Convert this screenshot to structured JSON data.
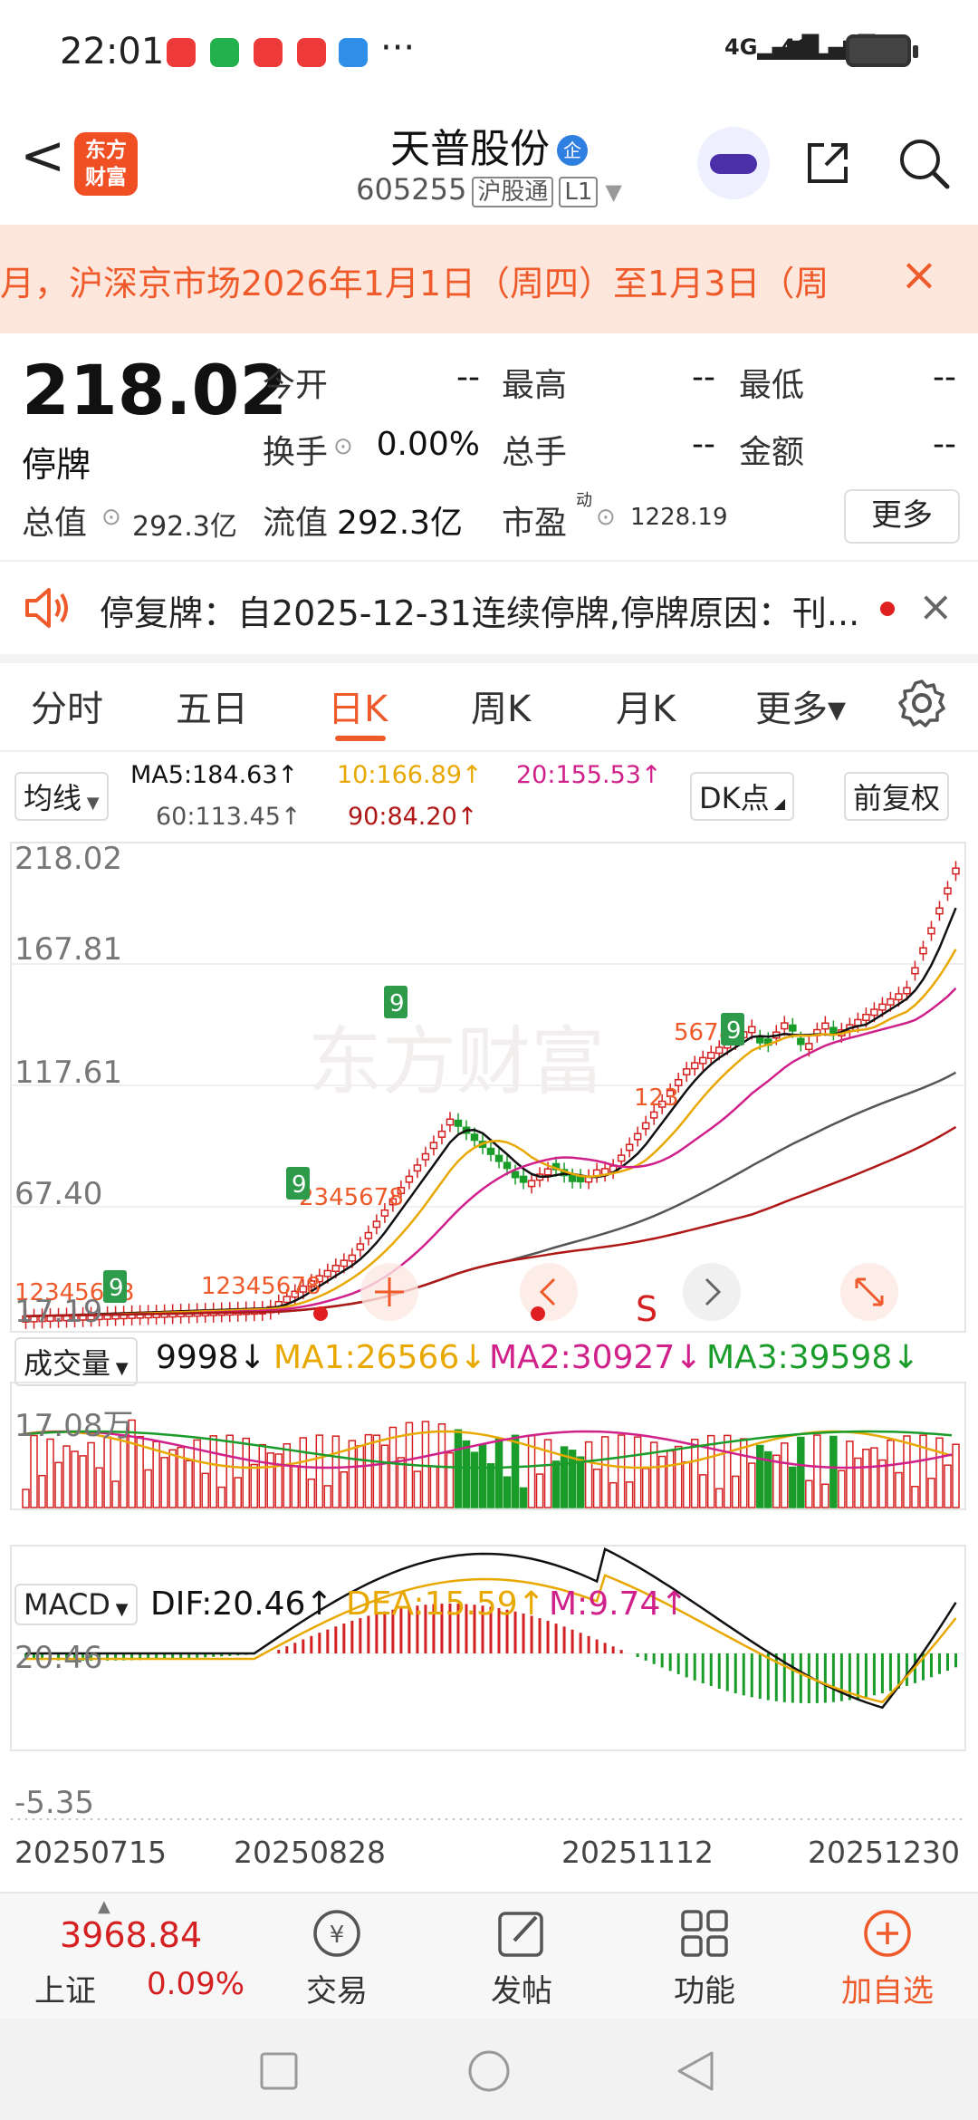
{
  "status_bar": {
    "time": "22:01",
    "dots": "···",
    "net1": "4G",
    "net2": "4G"
  },
  "header": {
    "back": "<",
    "logo_line1": "东方",
    "logo_line2": "财富",
    "stock_name": "天普股份",
    "badge": "企",
    "code": "605255",
    "tag1": "沪股通",
    "tag2": "L1"
  },
  "banner": {
    "text": "月，沪深京市场2026年1月1日（周四）至1月3日（周",
    "close": "×"
  },
  "quote": {
    "price": "218.02",
    "status": "停牌",
    "open_label": "今开",
    "open_value": "--",
    "high_label": "最高",
    "high_value": "--",
    "low_label": "最低",
    "low_value": "--",
    "turnover_label": "换手",
    "turnover_value": "0.00%",
    "hands_label": "总手",
    "hands_value": "--",
    "amount_label": "金额",
    "amount_value": "--",
    "total_cap_label": "总值",
    "total_cap_value": "292.3亿",
    "float_cap_label": "流值",
    "float_cap_value": "292.3亿",
    "pe_label": "市盈",
    "pe_sup": "动",
    "pe_value": "1228.19",
    "more_button": "更多"
  },
  "notice": {
    "text": "停复牌：自2025-12-31连续停牌,停牌原因：刊...",
    "close": "×"
  },
  "tabs": [
    "分时",
    "五日",
    "日K",
    "周K",
    "月K",
    "更多▾"
  ],
  "ma_row": {
    "select": "均线",
    "ma5": "MA5:184.63↑",
    "ma10": "10:166.89↑",
    "ma20": "20:155.53↑",
    "ma60": "60:113.45↑",
    "ma90": "90:84.20↑",
    "dk_button": "DK点",
    "adjust_button": "前复权"
  },
  "kline": {
    "y_labels": [
      "218.02",
      "167.81",
      "117.61",
      "67.40",
      "17.19"
    ],
    "watermark": "东方财富",
    "s_marker": "S",
    "seq_labels": [
      "12345678",
      "12345678",
      "2345678",
      "123",
      "5678"
    ],
    "nine_labels": [
      "9",
      "9",
      "9",
      "9"
    ],
    "colors": {
      "up": "#d42020",
      "down": "#1a9c2a",
      "ma5": "#111111",
      "ma10": "#e8a800",
      "ma20": "#d0208a",
      "ma60": "#555555",
      "ma90": "#b01818"
    }
  },
  "volume": {
    "select": "成交量",
    "value": "9998↓",
    "ma1": "MA1:26566↓",
    "ma2": "MA2:30927↓",
    "ma3": "MA3:39598↓",
    "top_label": "17.08万"
  },
  "macd": {
    "select": "MACD",
    "dif": "DIF:20.46↑",
    "dea": "DEA:15.59↑",
    "m": "M:9.74↑",
    "top_label": "20.46",
    "bottom_label": "-5.35"
  },
  "dates": [
    "20250715",
    "20250828",
    "20251112",
    "20251230"
  ],
  "bottom_nav": {
    "index_value": "3968.84",
    "index_name": "上证",
    "index_change": "0.09%",
    "trade": "交易",
    "post": "发帖",
    "function": "功能",
    "add": "加自选"
  }
}
